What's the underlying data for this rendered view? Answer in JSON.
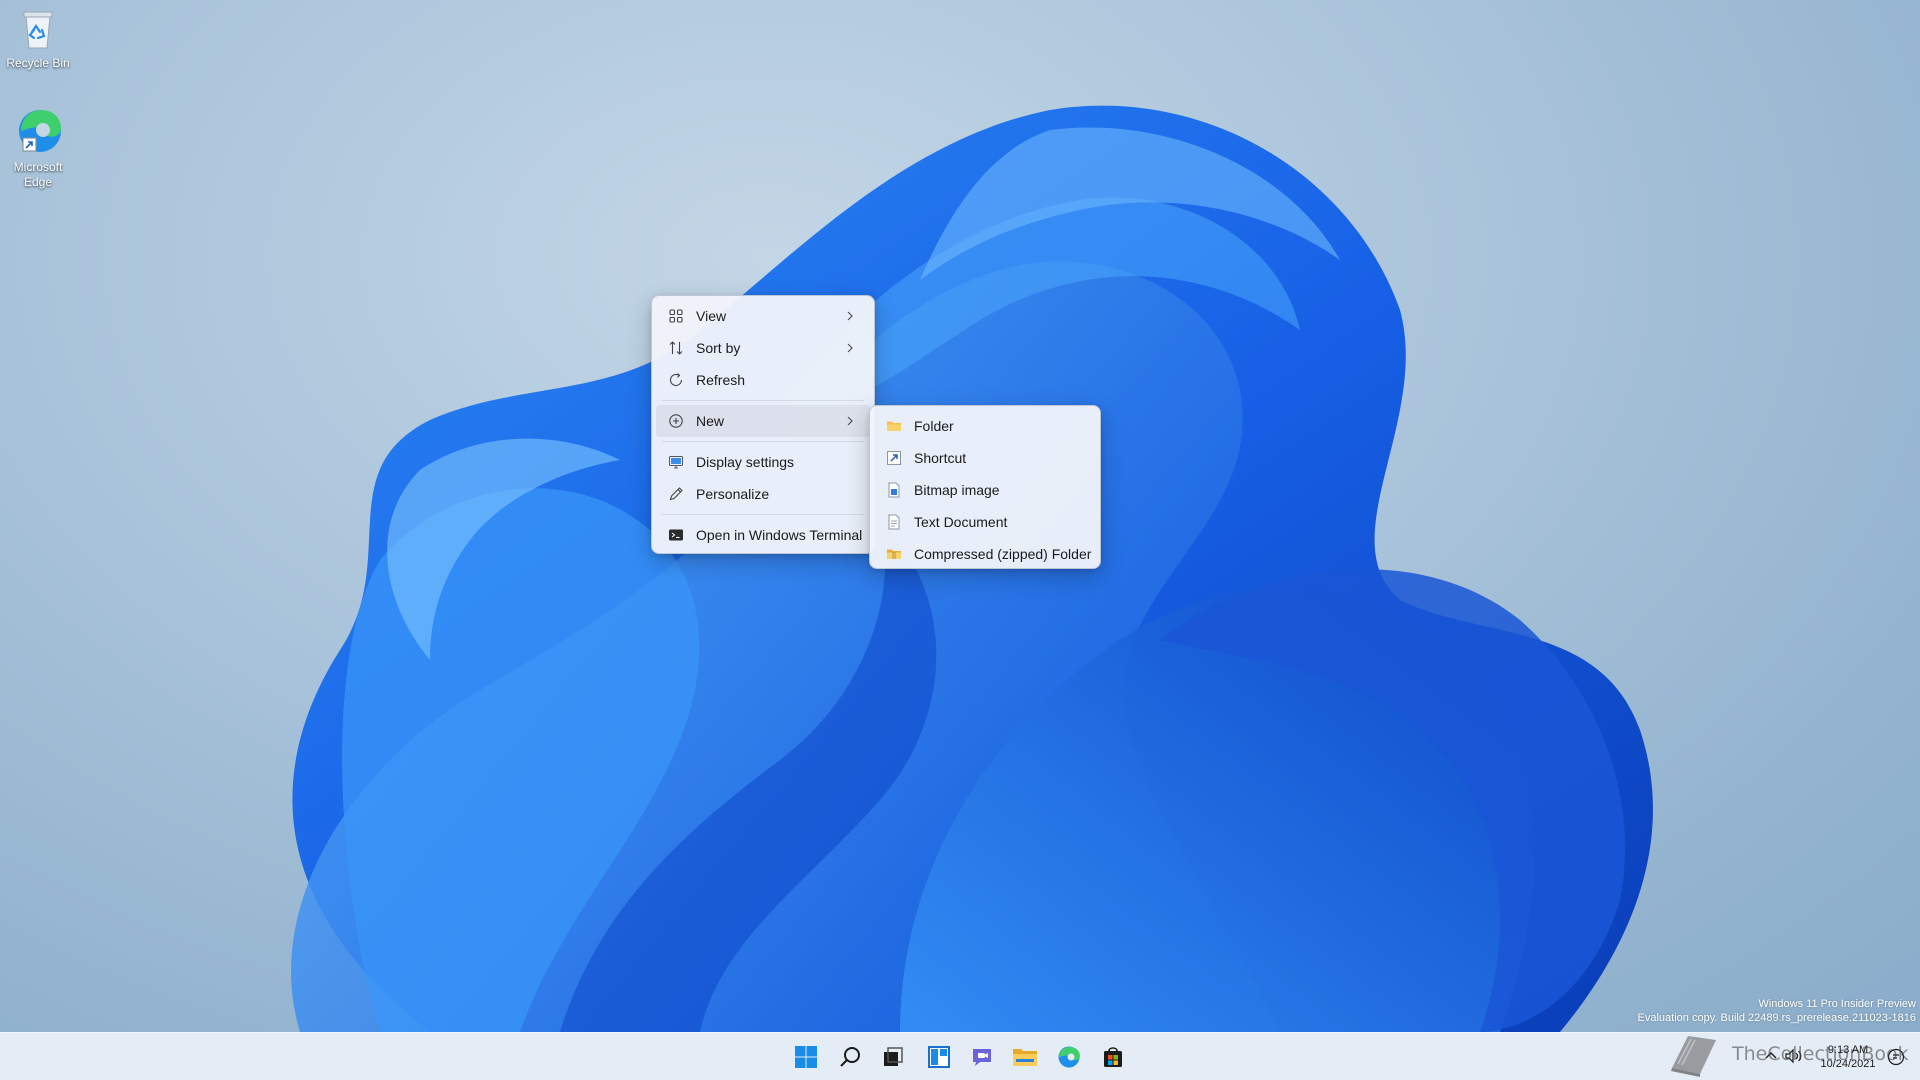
{
  "desktop_icons": [
    {
      "label": "Recycle Bin"
    },
    {
      "label": "Microsoft Edge"
    }
  ],
  "context_menu": {
    "items": [
      {
        "label": "View",
        "icon": "view-grid-icon",
        "has_submenu": true
      },
      {
        "label": "Sort by",
        "icon": "sort-icon",
        "has_submenu": true
      },
      {
        "label": "Refresh",
        "icon": "refresh-icon",
        "has_submenu": false
      },
      {
        "label": "New",
        "icon": "plus-circle-icon",
        "has_submenu": true
      },
      {
        "label": "Display settings",
        "icon": "display-settings-icon",
        "has_submenu": false
      },
      {
        "label": "Personalize",
        "icon": "pen-icon",
        "has_submenu": false
      },
      {
        "label": "Open in Windows Terminal",
        "icon": "terminal-icon",
        "has_submenu": false
      }
    ]
  },
  "new_submenu": {
    "items": [
      {
        "label": "Folder",
        "icon": "folder-icon"
      },
      {
        "label": "Shortcut",
        "icon": "shortcut-icon"
      },
      {
        "label": "Bitmap image",
        "icon": "bitmap-icon"
      },
      {
        "label": "Text Document",
        "icon": "text-document-icon"
      },
      {
        "label": "Compressed (zipped) Folder",
        "icon": "zip-folder-icon"
      }
    ]
  },
  "watermark": {
    "line1": "Windows 11 Pro Insider Preview",
    "line2": "Evaluation copy. Build 22489.rs_prerelease.211023-1816"
  },
  "taskbar": {
    "apps": [
      "start-icon",
      "search-icon",
      "task-view-icon",
      "widgets-icon",
      "chat-icon",
      "file-explorer-icon",
      "edge-icon",
      "store-icon"
    ],
    "clock": {
      "time": "9:13 AM",
      "date": "10/24/2021"
    }
  },
  "site_logo": {
    "text": "TheCollectionBook"
  },
  "colors": {
    "accent": "#0067c0",
    "folder": "#f2c14e",
    "menu_bg": "#f0f4fa"
  }
}
